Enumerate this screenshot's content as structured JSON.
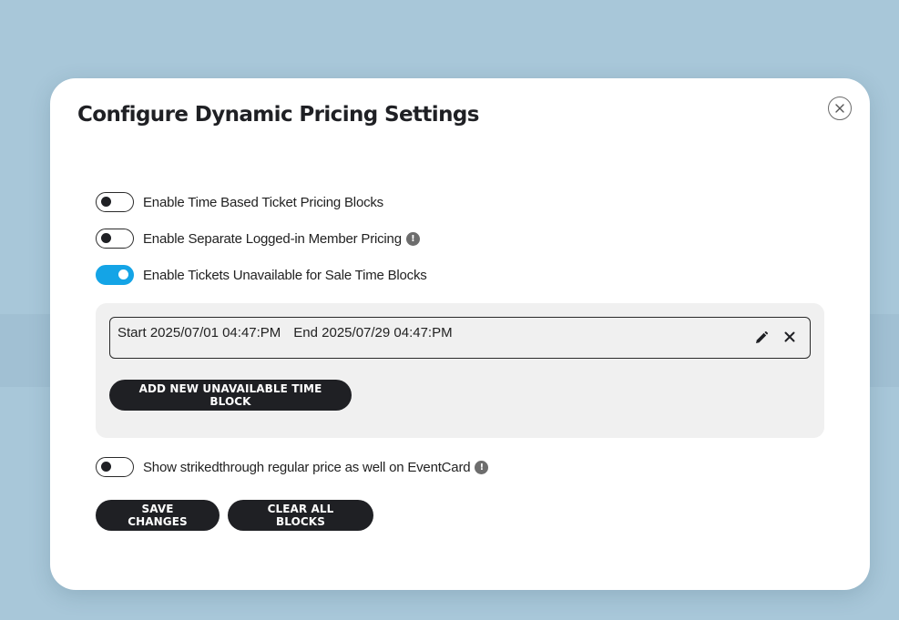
{
  "modal": {
    "title": "Configure Dynamic Pricing Settings",
    "close_icon": "close-circle-icon"
  },
  "toggles": [
    {
      "label": "Enable Time Based Ticket Pricing Blocks",
      "on": false,
      "info": false
    },
    {
      "label": "Enable Separate Logged-in Member Pricing",
      "on": false,
      "info": true
    },
    {
      "label": "Enable Tickets Unavailable for Sale Time Blocks",
      "on": true,
      "info": true
    }
  ],
  "unavailable_blocks": {
    "items": [
      {
        "start": "Start 2025/07/01 04:47:PM",
        "end": "End 2025/07/29 04:47:PM"
      }
    ],
    "add_label": "ADD NEW UNAVAILABLE TIME BLOCK"
  },
  "strikethrough_toggle": {
    "label": "Show strikedthrough regular price as well on EventCard",
    "on": false
  },
  "info_glyph": "!",
  "actions": {
    "save_label": "SAVE CHANGES",
    "clear_label": "CLEAR ALL BLOCKS"
  },
  "colors": {
    "backdrop": "#a8c7d9",
    "accent_toggle": "#14a4e6",
    "button_bg": "#1f2024",
    "panel_bg": "#f0f0f0"
  }
}
